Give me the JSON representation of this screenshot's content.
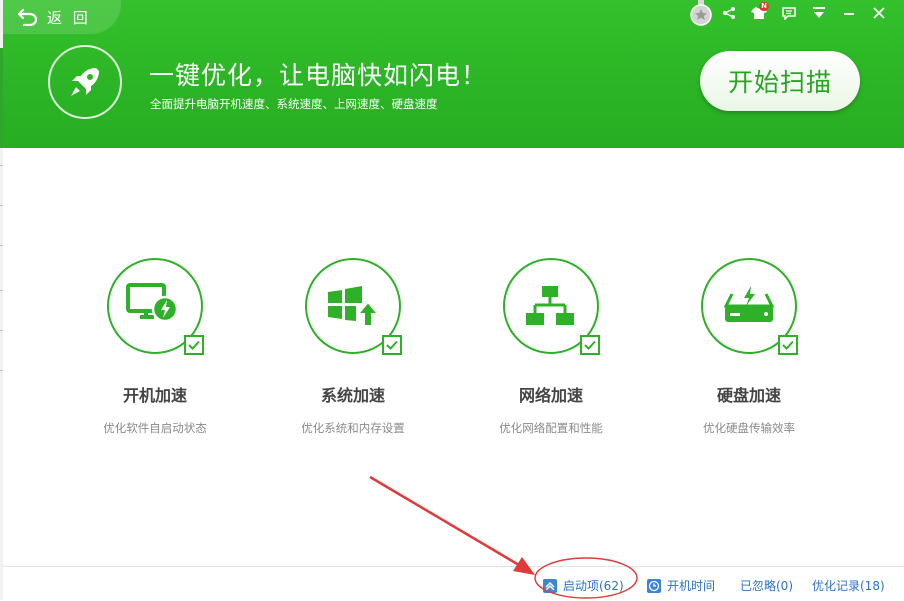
{
  "back": {
    "label": "返 回",
    "icon": "back-arrow-icon"
  },
  "header": {
    "headline": "一键优化，让电脑快如闪电！",
    "subline": "全面提升电脑开机速度、系统速度、上网速度、硬盘速度",
    "scan_button": "开始扫描",
    "brand_color": "#2cb526"
  },
  "window_controls": {
    "badge": "N",
    "icons": [
      "medal-icon",
      "share-icon",
      "skin-icon",
      "feedback-icon",
      "menu-icon",
      "minimize-icon",
      "close-icon"
    ]
  },
  "features": [
    {
      "title": "开机加速",
      "desc": "优化软件自启动状态",
      "icon": "monitor-bolt-icon",
      "checked": true
    },
    {
      "title": "系统加速",
      "desc": "优化系统和内存设置",
      "icon": "windows-up-icon",
      "checked": true
    },
    {
      "title": "网络加速",
      "desc": "优化网络配置和性能",
      "icon": "network-icon",
      "checked": true
    },
    {
      "title": "硬盘加速",
      "desc": "优化硬盘传输效率",
      "icon": "harddisk-bolt-icon",
      "checked": true
    }
  ],
  "footer": {
    "startup": "启动项(62)",
    "boot_time": "开机时间",
    "ignored": "已忽略(0)",
    "history": "优化记录(18)",
    "link_color": "#2e72c4"
  },
  "annotation_color": "#e03a3a"
}
